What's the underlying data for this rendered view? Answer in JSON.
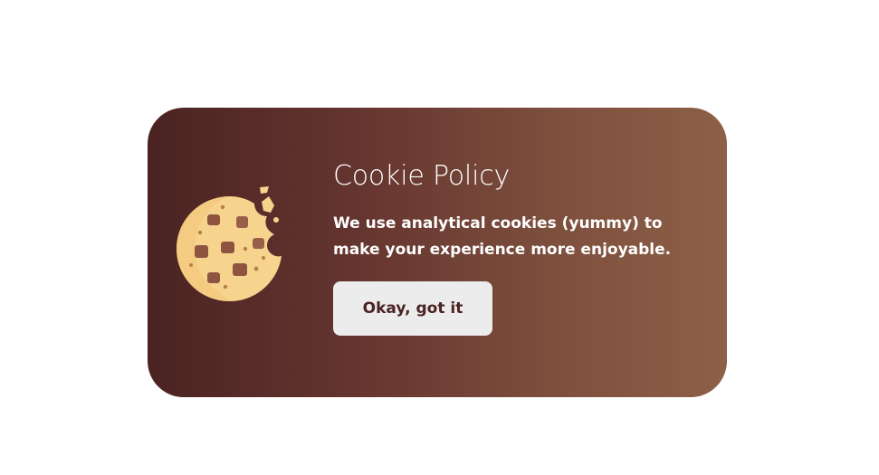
{
  "cookie_banner": {
    "title": "Cookie Policy",
    "message": "We use analytical cookies (yummy) to make your experience more enjoyable.",
    "accept_label": "Okay, got it",
    "icon": "cookie-icon",
    "colors": {
      "gradient_start": "#4a2322",
      "gradient_end": "#8d6048",
      "button_bg": "#ececec",
      "button_text": "#4a2322"
    }
  }
}
